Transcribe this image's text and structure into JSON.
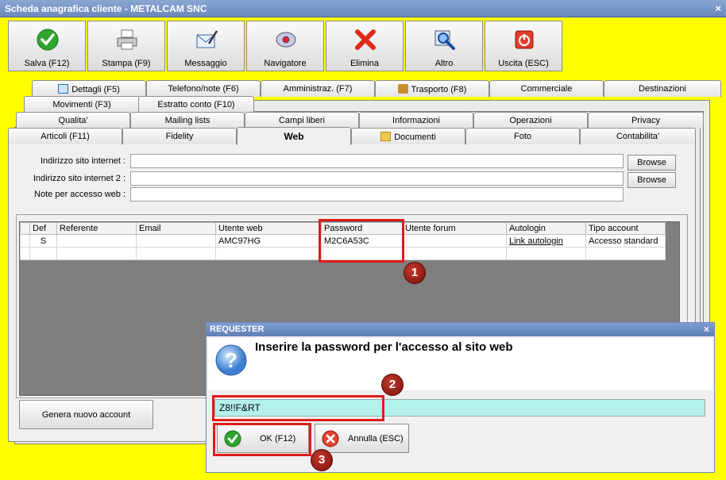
{
  "window": {
    "title": "Scheda anagrafica cliente - METALCAM SNC",
    "close": "×"
  },
  "toolbar": [
    {
      "name": "save",
      "label": "Salva (F12)",
      "icon": "check-circle-icon"
    },
    {
      "name": "print",
      "label": "Stampa (F9)",
      "icon": "printer-icon"
    },
    {
      "name": "message",
      "label": "Messaggio",
      "icon": "mail-icon"
    },
    {
      "name": "navigator",
      "label": "Navigatore",
      "icon": "compass-icon"
    },
    {
      "name": "delete",
      "label": "Elimina",
      "icon": "red-x-icon"
    },
    {
      "name": "other",
      "label": "Altro",
      "icon": "magnifier-icon"
    },
    {
      "name": "exit",
      "label": "Uscita (ESC)",
      "icon": "power-icon"
    }
  ],
  "tabs": {
    "row1": [
      "Dettagli (F5)",
      "Telefono/note (F6)",
      "Amministraz. (F7)",
      "Trasporto (F8)",
      "Commerciale",
      "Destinazioni"
    ],
    "row2": [
      "Movimenti (F3)",
      "Estratto conto (F10)"
    ],
    "row3": [
      "Qualita'",
      "Mailing lists",
      "Campi liberi",
      "Informazioni",
      "Operazioni",
      "Privacy"
    ],
    "row4": [
      "Articoli (F11)",
      "Fidelity",
      "Web",
      "Documenti",
      "Foto",
      "Contabilita'"
    ],
    "active": "Web"
  },
  "form": {
    "site_label": "Indirizzo sito internet :",
    "site2_label": "Indirizzo sito internet 2 :",
    "notes_label": "Note per accesso web :",
    "site_value": "",
    "site2_value": "",
    "notes_value": "",
    "browse_label": "Browse"
  },
  "grid": {
    "columns": [
      "Def",
      "Referente",
      "Email",
      "Utente web",
      "Password",
      "Utente forum",
      "Autologin",
      "Tipo account"
    ],
    "rows": [
      [
        "S",
        "",
        "",
        "AMC97HG",
        "M2C6A53C",
        "",
        "Link autologin",
        "Accesso standard"
      ]
    ]
  },
  "generate_button": "Genera nuovo account",
  "dialog": {
    "title": "REQUESTER",
    "close": "×",
    "message": "Inserire la password per l'accesso al sito web",
    "input_value": "Z8!!F&RT",
    "ok_label": "OK (F12)",
    "cancel_label": "Annulla (ESC)"
  },
  "annotations": [
    "1",
    "2",
    "3"
  ],
  "colors": {
    "background": "#ffff00",
    "highlight": "#e01b1b",
    "input": "#b4f0ec"
  }
}
